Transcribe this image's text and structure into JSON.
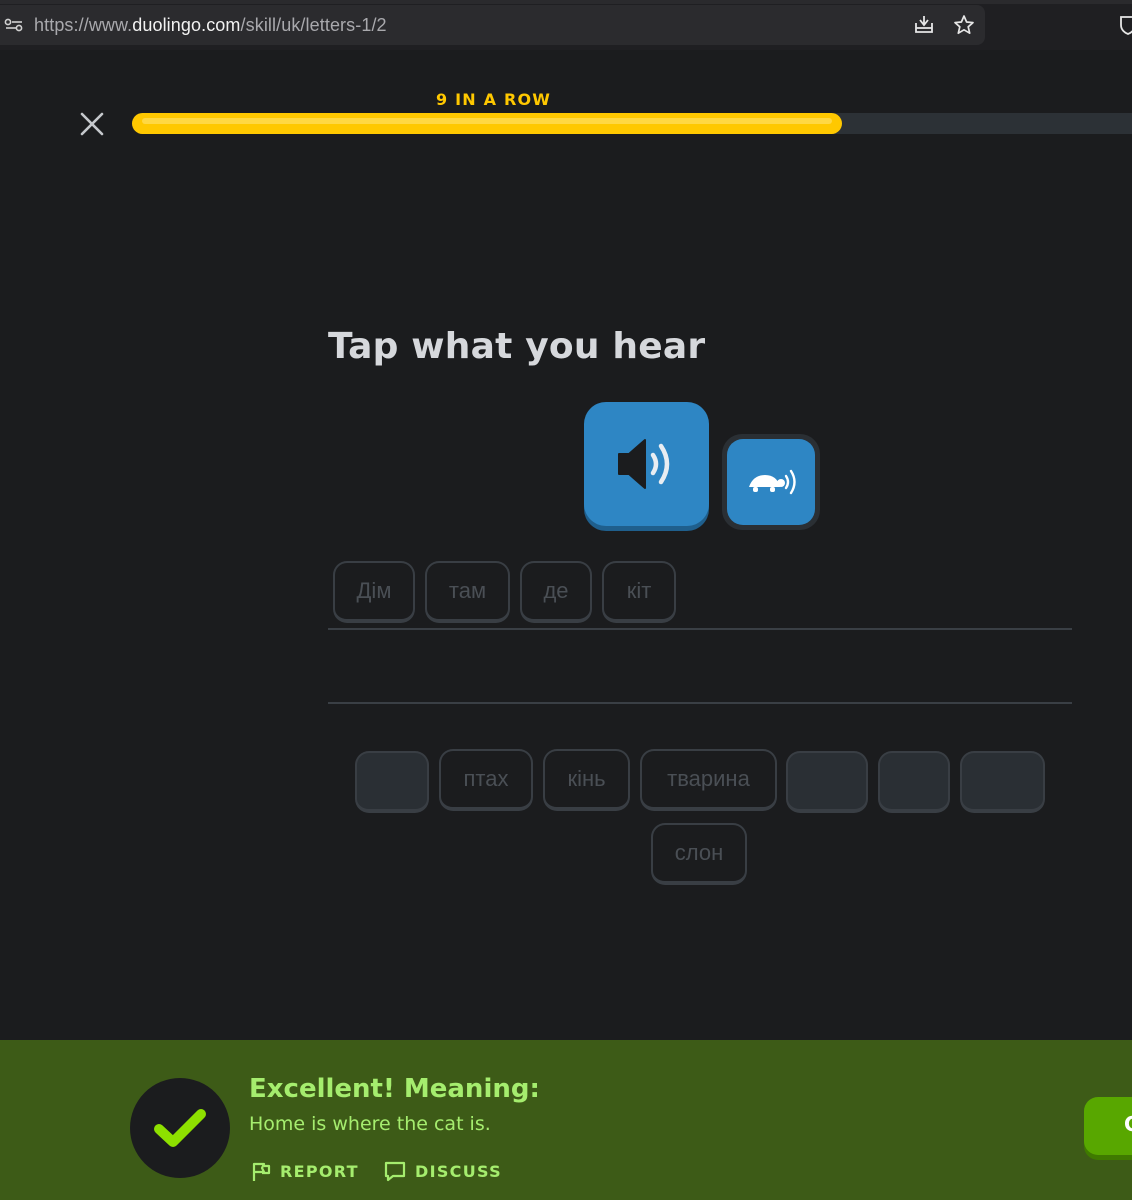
{
  "browser": {
    "url_prefix": "https://www.",
    "url_host": "duolingo.com",
    "url_path": "/skill/uk/letters-1/2"
  },
  "header": {
    "streak_text": "9 IN A ROW",
    "progress_fraction": 0.71
  },
  "challenge": {
    "title": "Tap what you hear"
  },
  "answer_tiles": [
    "Дім",
    "там",
    "де",
    "кіт"
  ],
  "word_bank": {
    "tiles": [
      "",
      "птах",
      "кінь",
      "тварина",
      "",
      "",
      "",
      "слон"
    ]
  },
  "footer": {
    "title": "Excellent! Meaning:",
    "meaning": "Home is where the cat is.",
    "report_label": "REPORT",
    "discuss_label": "DISCUSS",
    "continue_label": "C"
  },
  "colors": {
    "accent_yellow": "#ffc800",
    "audio_blue": "#2e86c4",
    "success_green": "#a5ed6e",
    "footer_bg": "#3d5b17"
  }
}
